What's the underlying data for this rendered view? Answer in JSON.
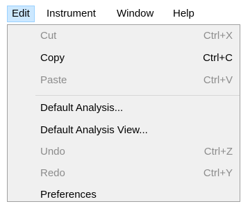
{
  "menubar": {
    "items": [
      {
        "label": "Edit"
      },
      {
        "label": "Instrument"
      },
      {
        "label": "Window"
      },
      {
        "label": "Help"
      }
    ]
  },
  "edit_menu": {
    "items": [
      {
        "label": "Cut",
        "shortcut": "Ctrl+X",
        "enabled": false
      },
      {
        "label": "Copy",
        "shortcut": "Ctrl+C",
        "enabled": true
      },
      {
        "label": "Paste",
        "shortcut": "Ctrl+V",
        "enabled": false
      },
      {
        "label": "Default Analysis...",
        "shortcut": "",
        "enabled": true
      },
      {
        "label": "Default Analysis View...",
        "shortcut": "",
        "enabled": true
      },
      {
        "label": "Undo",
        "shortcut": "Ctrl+Z",
        "enabled": false
      },
      {
        "label": "Redo",
        "shortcut": "Ctrl+Y",
        "enabled": false
      },
      {
        "label": "Preferences",
        "shortcut": "",
        "enabled": true
      }
    ]
  }
}
